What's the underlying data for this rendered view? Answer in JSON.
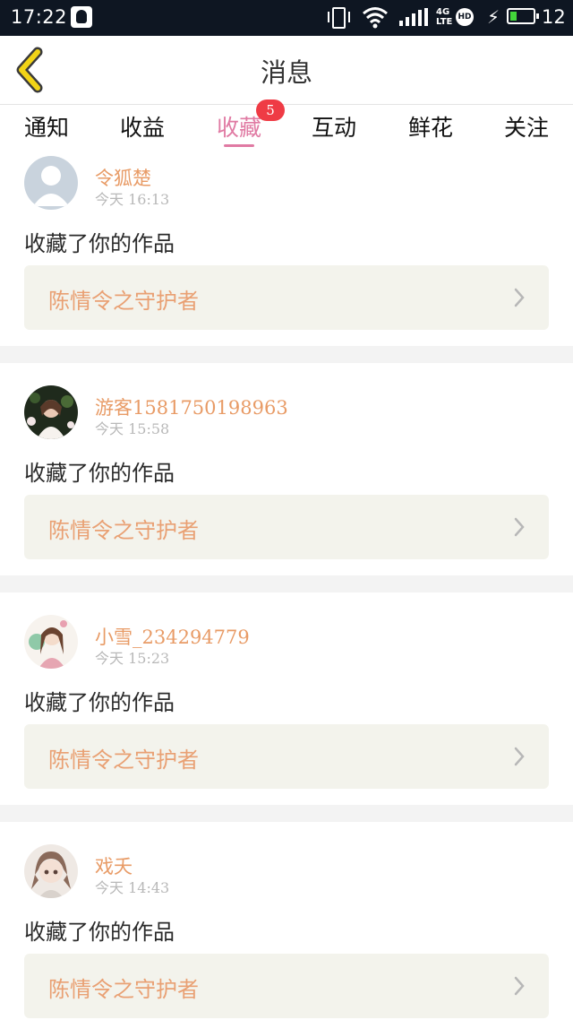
{
  "status_bar": {
    "time": "17:22",
    "network_label": "4G\nLTE",
    "hd_label": "HD",
    "battery_percent": 12,
    "battery_text": "12",
    "icons": [
      "qq-icon",
      "vibrate-icon",
      "wifi-icon",
      "signal-icon",
      "charging-icon",
      "battery-icon"
    ]
  },
  "header": {
    "title": "消息",
    "back_icon": "chevron-left-icon"
  },
  "tabs": {
    "items": [
      {
        "label": "通知"
      },
      {
        "label": "收益"
      },
      {
        "label": "收藏"
      },
      {
        "label": "互动"
      },
      {
        "label": "鲜花"
      },
      {
        "label": "关注"
      }
    ],
    "active_index": 2,
    "badge": "5"
  },
  "messages": [
    {
      "sender": "令狐楚",
      "time": "今天  16:13",
      "action": "收藏了你的作品",
      "work_title": "陈情令之守护者",
      "avatar": "default-avatar"
    },
    {
      "sender": "游客1581750198963",
      "time": "今天  15:58",
      "action": "收藏了你的作品",
      "work_title": "陈情令之守护者",
      "avatar": "photo-avatar"
    },
    {
      "sender": "小雪_234294779",
      "time": "今天  15:23",
      "action": "收藏了你的作品",
      "work_title": "陈情令之守护者",
      "avatar": "anime-avatar"
    },
    {
      "sender": "戏夭",
      "time": "今天  14:43",
      "action": "收藏了你的作品",
      "work_title": "陈情令之守护者",
      "avatar": "anime-avatar"
    }
  ],
  "colors": {
    "accent_pink": "#e07aa3",
    "sender_orange": "#e89b66",
    "badge_red": "#ef3b45",
    "card_bg": "#f3f3ec",
    "status_bar_bg": "#0e1622",
    "back_icon_yellow": "#f2d417"
  }
}
